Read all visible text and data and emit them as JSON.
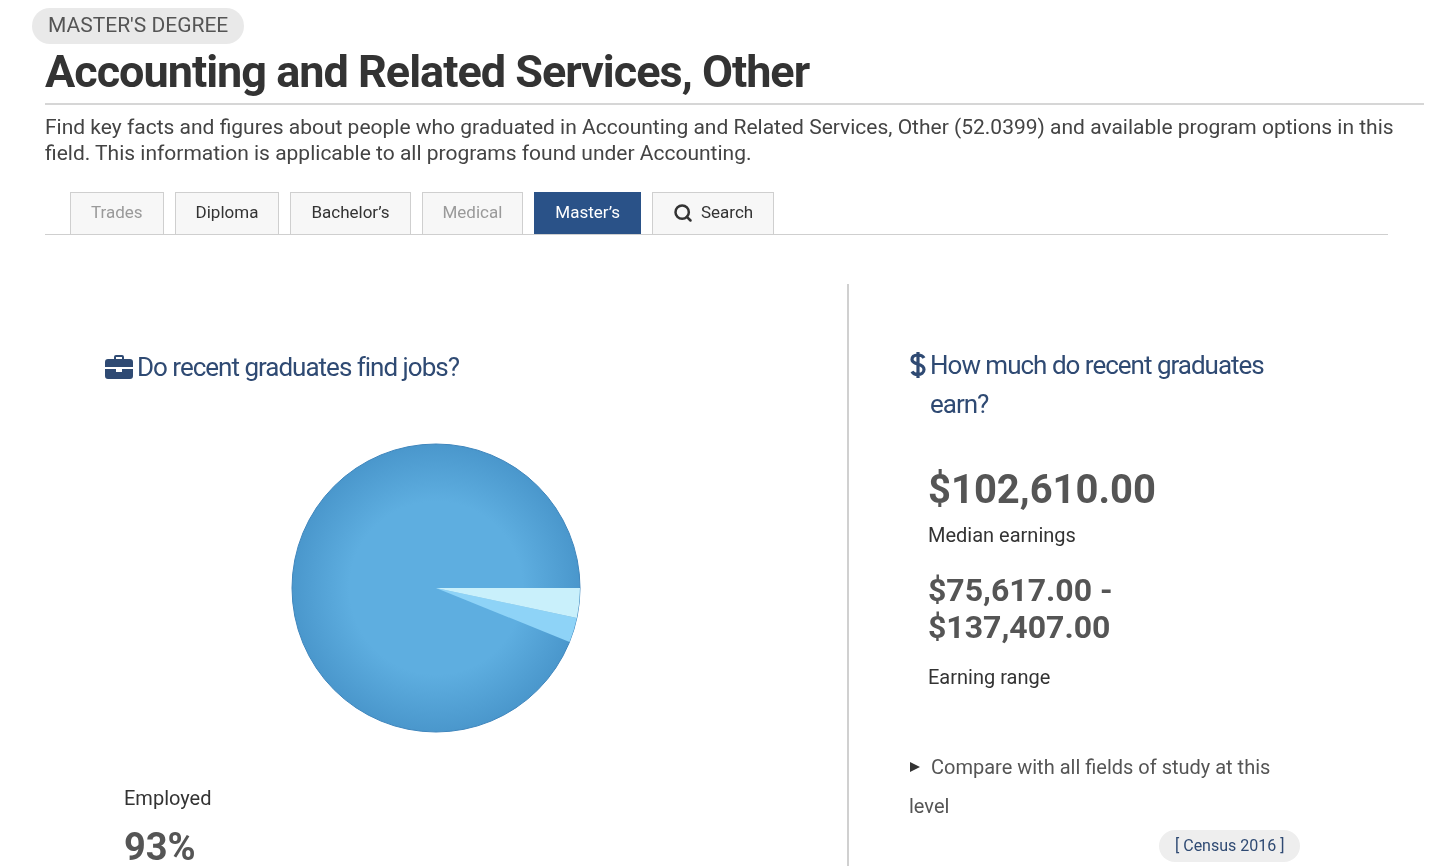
{
  "badge": "MASTER'S DEGREE",
  "title": "Accounting and Related Services, Other",
  "description": "Find key facts and figures about people who graduated in Accounting and Related Services, Other (52.0399) and available program options in this field. This information is applicable to all programs found under Accounting.",
  "tabs": [
    {
      "label": "Trades",
      "kind": "level",
      "selected": false,
      "disabled": true
    },
    {
      "label": "Diploma",
      "kind": "level",
      "selected": false,
      "disabled": false
    },
    {
      "label": "Bachelor’s",
      "kind": "level",
      "selected": false,
      "disabled": false
    },
    {
      "label": "Medical",
      "kind": "level",
      "selected": false,
      "disabled": true
    },
    {
      "label": "Master’s",
      "kind": "level",
      "selected": true,
      "disabled": false
    },
    {
      "label": "Search",
      "kind": "search",
      "selected": false,
      "disabled": false
    }
  ],
  "jobs": {
    "heading": "Do recent graduates find jobs?",
    "stat_label": "Employed",
    "stat_value": "93%"
  },
  "earnings": {
    "heading": "How much do recent graduates earn?",
    "median": "$102,610.00",
    "median_label": "Median earnings",
    "range": "$75,617.00 - $137,407.00",
    "range_label": "Earning range",
    "compare": "Compare with all fields of study at this level",
    "compare_expanded": false,
    "source": "[ Census 2016 ]"
  }
}
